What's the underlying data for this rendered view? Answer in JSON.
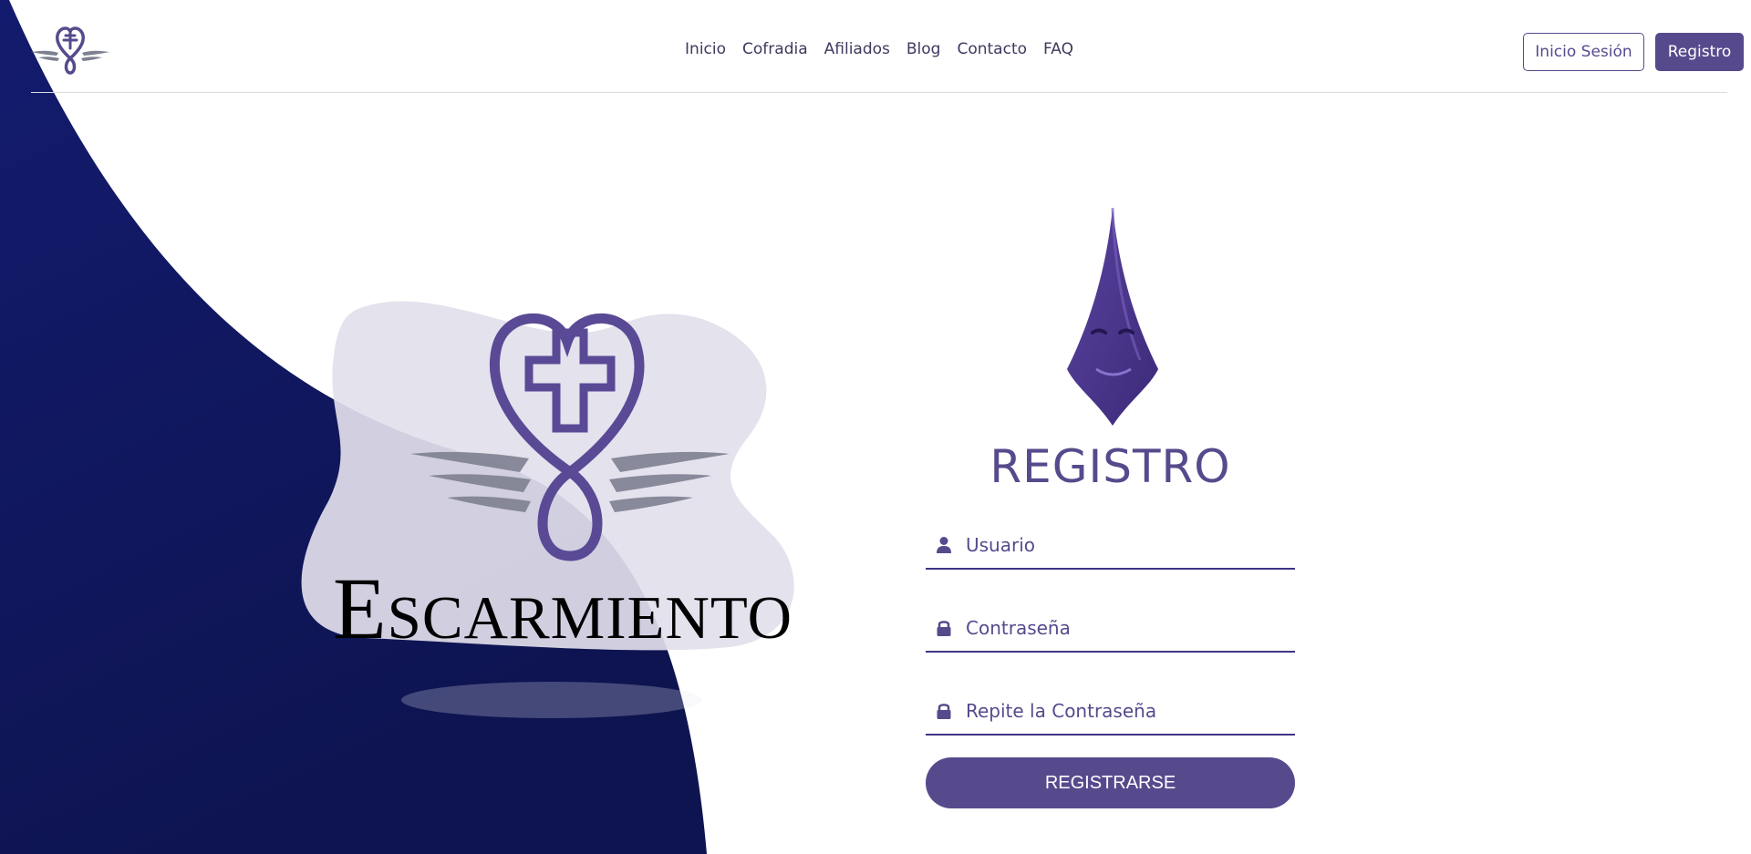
{
  "nav": {
    "links": [
      "Inicio",
      "Cofradia",
      "Afiliados",
      "Blog",
      "Contacto",
      "FAQ"
    ],
    "login_label": "Inicio Sesión",
    "register_label": "Registro"
  },
  "hero": {
    "brand_name": "Escarmiento"
  },
  "form": {
    "title": "REGISTRO",
    "username_placeholder": "Usuario",
    "password_placeholder": "Contraseña",
    "repeat_password_placeholder": "Repite la Contraseña",
    "submit_label": "REGISTRARSE"
  },
  "colors": {
    "accent": "#574a8c",
    "navy": "#131b63",
    "blob": "#e2e0ec",
    "wing": "#7d8090"
  },
  "icons": [
    "heart-cross-logo-icon",
    "hood-icon",
    "user-icon",
    "lock-icon"
  ]
}
